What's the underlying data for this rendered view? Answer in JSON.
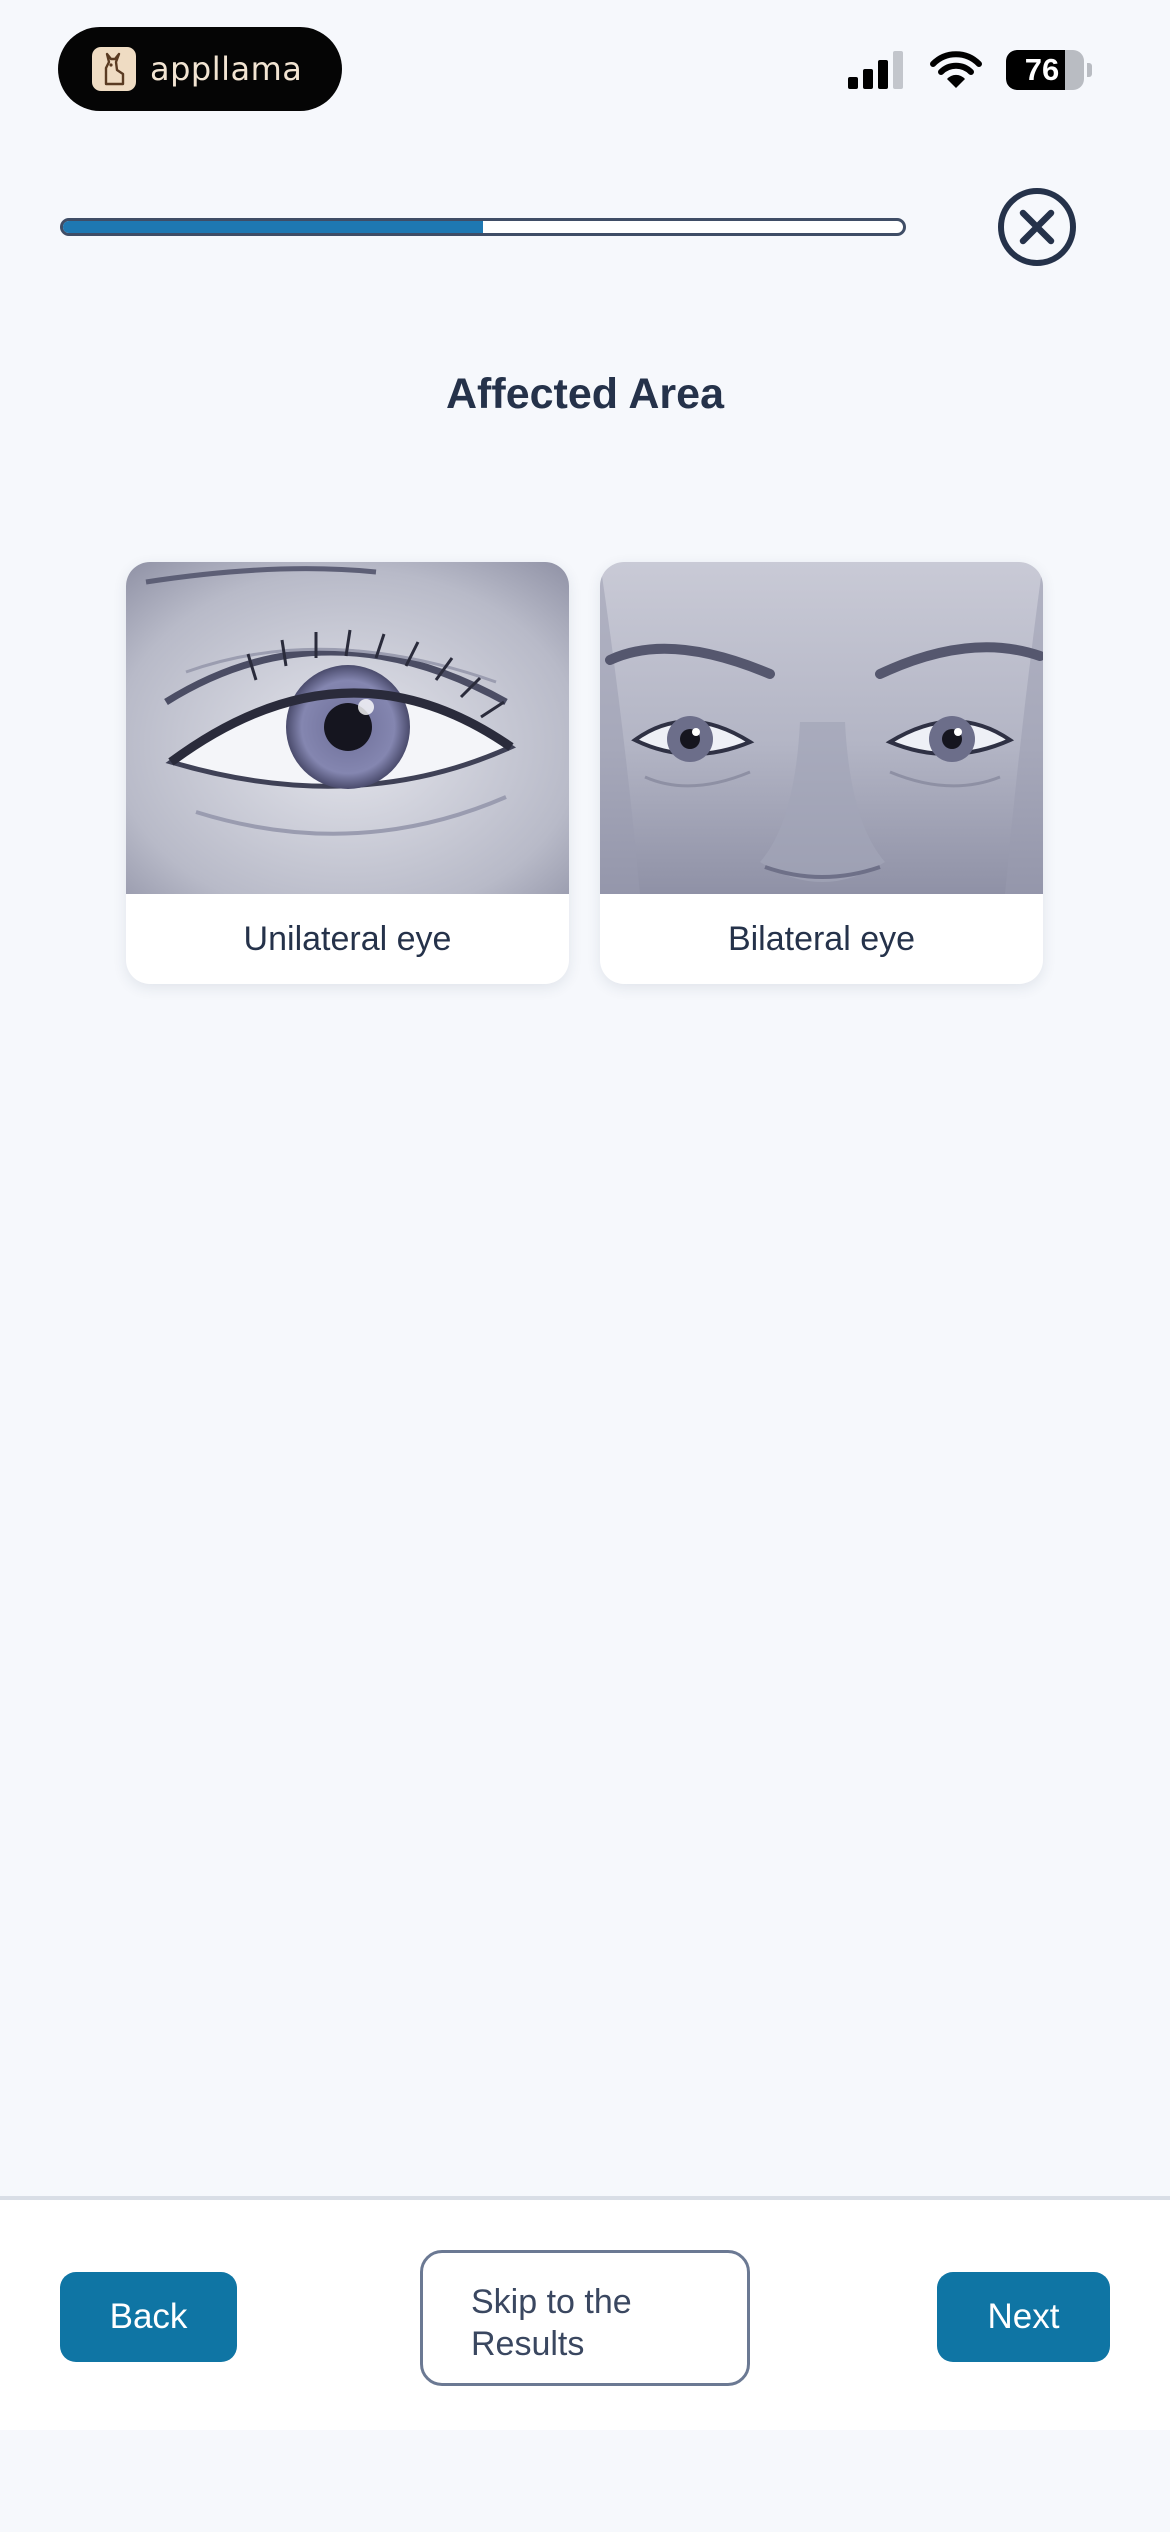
{
  "status_bar": {
    "app_name": "appllama",
    "battery": 76,
    "battery_label": "76"
  },
  "progress": {
    "value": 0.5
  },
  "page": {
    "title": "Affected Area"
  },
  "options": [
    {
      "label": "Unilateral eye",
      "icon": "single-eye-illustration"
    },
    {
      "label": "Bilateral eye",
      "icon": "both-eyes-illustration"
    }
  ],
  "footer": {
    "back_label": "Back",
    "skip_label": "Skip to the Results",
    "next_label": "Next"
  },
  "colors": {
    "background": "#f6f8fc",
    "primary": "#0f75a4",
    "progress": "#1e78b2",
    "text": "#25324a"
  }
}
